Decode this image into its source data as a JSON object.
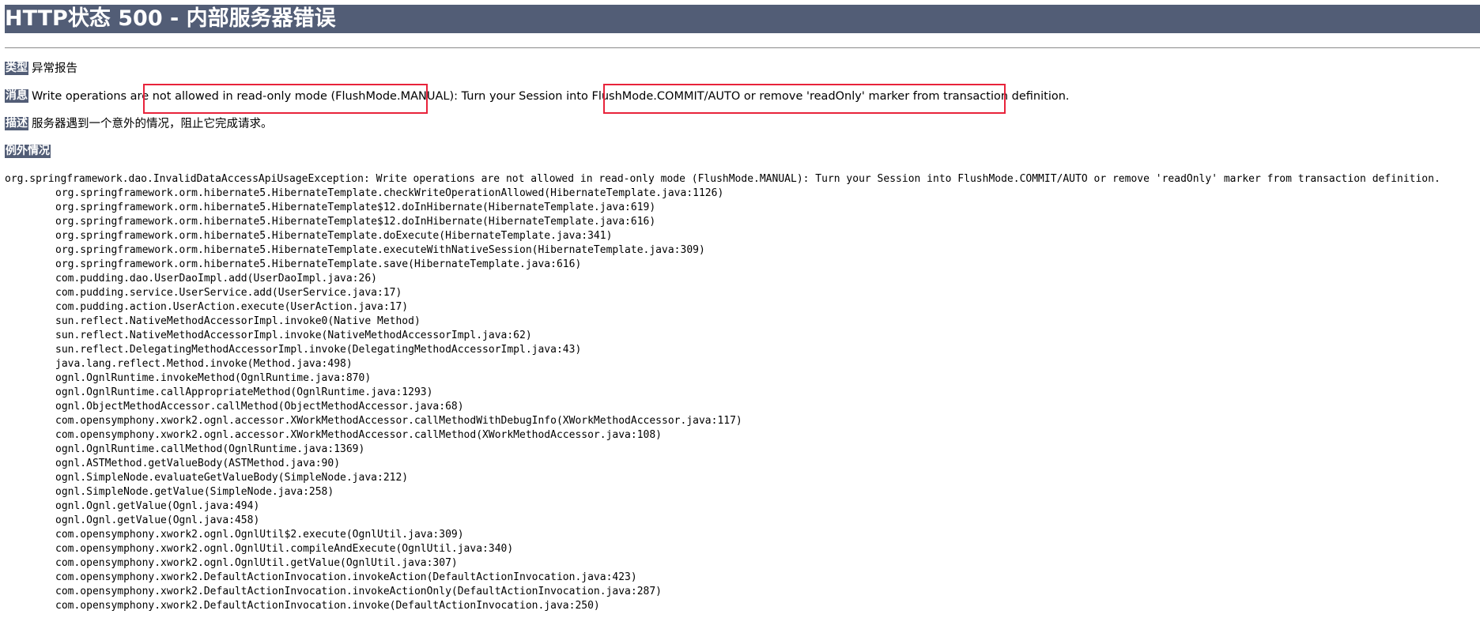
{
  "header": {
    "title": "HTTP状态 500 - 内部服务器错误"
  },
  "report": {
    "type_label": "类型",
    "type_value": "异常报告",
    "message_label": "消息",
    "message_value": "Write operations are not allowed in read-only mode (FlushMode.MANUAL): Turn your Session into FlushMode.COMMIT/AUTO or remove 'readOnly' marker from transaction definition.",
    "description_label": "描述",
    "description_value": "服务器遇到一个意外的情况，阻止它完成请求。",
    "exception_label": "例外情况"
  },
  "highlight_color": "#e8233b",
  "accent_color": "#525d76",
  "stack_trace": {
    "exception_line": "org.springframework.dao.InvalidDataAccessApiUsageException: Write operations are not allowed in read-only mode (FlushMode.MANUAL): Turn your Session into FlushMode.COMMIT/AUTO or remove 'readOnly' marker from transaction definition.",
    "frames": [
      "org.springframework.orm.hibernate5.HibernateTemplate.checkWriteOperationAllowed(HibernateTemplate.java:1126)",
      "org.springframework.orm.hibernate5.HibernateTemplate$12.doInHibernate(HibernateTemplate.java:619)",
      "org.springframework.orm.hibernate5.HibernateTemplate$12.doInHibernate(HibernateTemplate.java:616)",
      "org.springframework.orm.hibernate5.HibernateTemplate.doExecute(HibernateTemplate.java:341)",
      "org.springframework.orm.hibernate5.HibernateTemplate.executeWithNativeSession(HibernateTemplate.java:309)",
      "org.springframework.orm.hibernate5.HibernateTemplate.save(HibernateTemplate.java:616)",
      "com.pudding.dao.UserDaoImpl.add(UserDaoImpl.java:26)",
      "com.pudding.service.UserService.add(UserService.java:17)",
      "com.pudding.action.UserAction.execute(UserAction.java:17)",
      "sun.reflect.NativeMethodAccessorImpl.invoke0(Native Method)",
      "sun.reflect.NativeMethodAccessorImpl.invoke(NativeMethodAccessorImpl.java:62)",
      "sun.reflect.DelegatingMethodAccessorImpl.invoke(DelegatingMethodAccessorImpl.java:43)",
      "java.lang.reflect.Method.invoke(Method.java:498)",
      "ognl.OgnlRuntime.invokeMethod(OgnlRuntime.java:870)",
      "ognl.OgnlRuntime.callAppropriateMethod(OgnlRuntime.java:1293)",
      "ognl.ObjectMethodAccessor.callMethod(ObjectMethodAccessor.java:68)",
      "com.opensymphony.xwork2.ognl.accessor.XWorkMethodAccessor.callMethodWithDebugInfo(XWorkMethodAccessor.java:117)",
      "com.opensymphony.xwork2.ognl.accessor.XWorkMethodAccessor.callMethod(XWorkMethodAccessor.java:108)",
      "ognl.OgnlRuntime.callMethod(OgnlRuntime.java:1369)",
      "ognl.ASTMethod.getValueBody(ASTMethod.java:90)",
      "ognl.SimpleNode.evaluateGetValueBody(SimpleNode.java:212)",
      "ognl.SimpleNode.getValue(SimpleNode.java:258)",
      "ognl.Ognl.getValue(Ognl.java:494)",
      "ognl.Ognl.getValue(Ognl.java:458)",
      "com.opensymphony.xwork2.ognl.OgnlUtil$2.execute(OgnlUtil.java:309)",
      "com.opensymphony.xwork2.ognl.OgnlUtil.compileAndExecute(OgnlUtil.java:340)",
      "com.opensymphony.xwork2.ognl.OgnlUtil.getValue(OgnlUtil.java:307)",
      "com.opensymphony.xwork2.DefaultActionInvocation.invokeAction(DefaultActionInvocation.java:423)",
      "com.opensymphony.xwork2.DefaultActionInvocation.invokeActionOnly(DefaultActionInvocation.java:287)",
      "com.opensymphony.xwork2.DefaultActionInvocation.invoke(DefaultActionInvocation.java:250)"
    ]
  }
}
